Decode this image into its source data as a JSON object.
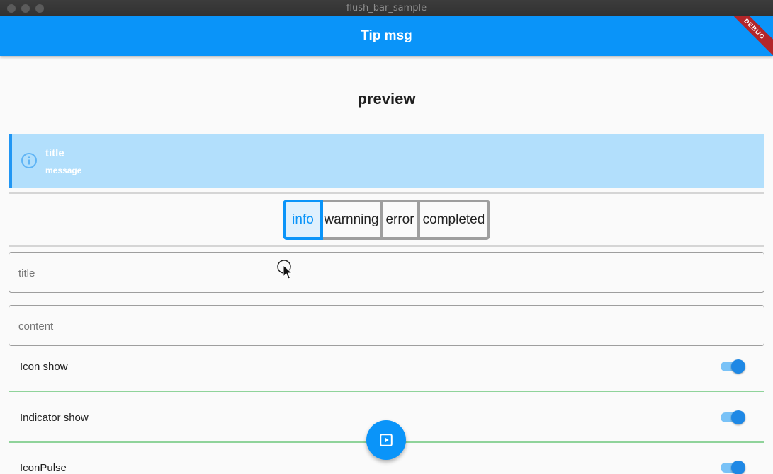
{
  "window": {
    "title": "flush_bar_sample"
  },
  "appbar": {
    "title": "Tip msg",
    "debug_label": "DEBUG"
  },
  "preview": {
    "heading": "preview"
  },
  "banner": {
    "title": "title",
    "message": "message",
    "icon": "info-icon",
    "accent": "#2196f3",
    "background": "#b2dffc"
  },
  "segments": {
    "items": [
      "info",
      "warnning",
      "error",
      "completed"
    ],
    "selected": "info"
  },
  "inputs": {
    "title": {
      "placeholder": "title",
      "value": ""
    },
    "content": {
      "placeholder": "content",
      "value": ""
    }
  },
  "toggles": [
    {
      "label": "Icon show",
      "on": true
    },
    {
      "label": "Indicator show",
      "on": true
    },
    {
      "label": "IconPulse",
      "on": true
    }
  ],
  "fab": {
    "icon": "play-icon"
  },
  "colors": {
    "primary": "#0a94f9",
    "divider_green": "#8fd39a"
  }
}
